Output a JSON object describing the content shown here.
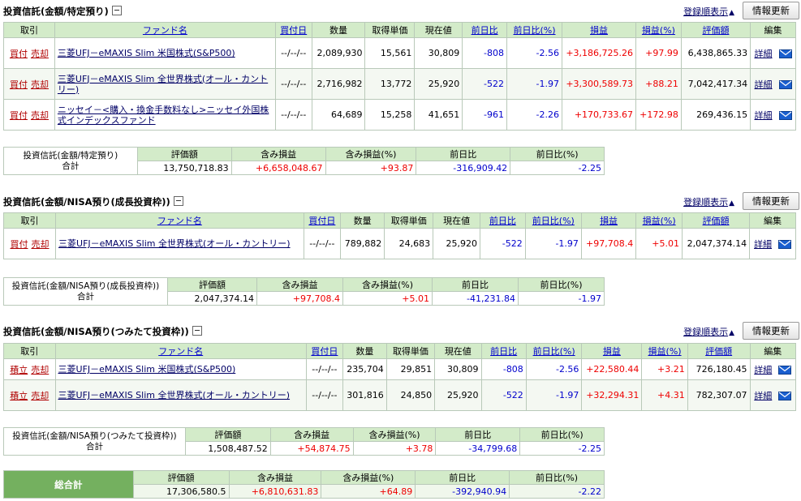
{
  "common": {
    "sort_link": "登録順表示",
    "refresh": "情報更新",
    "edit_detail": "詳細",
    "cols": {
      "trade": "取引",
      "fund": "ファンド名",
      "buy_date": "買付日",
      "qty": "数量",
      "cost": "取得単価",
      "price": "現在値",
      "day_change": "前日比",
      "day_change_pct": "前日比(%)",
      "pl": "損益",
      "pl_pct": "損益(%)",
      "value": "評価額",
      "edit": "編集"
    },
    "sum_cols": {
      "value": "評価額",
      "unrealized": "含み損益",
      "unrealized_pct": "含み損益(%)",
      "day_change": "前日比",
      "day_change_pct": "前日比(%)"
    },
    "total_label": "合計"
  },
  "sections": [
    {
      "title": "投資信託(金額/特定預り)",
      "rows": [
        {
          "act1": "買付",
          "act2": "売却",
          "fund": "三菱UFJ－eMAXIS Slim 米国株式(S&P500)",
          "date": "--/--/--",
          "qty": "2,089,930",
          "cost": "15,561",
          "price": "30,809",
          "chg": "-808",
          "chg_pct": "-2.56",
          "pl": "+3,186,725.26",
          "pl_pct": "+97.99",
          "value": "6,438,865.33"
        },
        {
          "act1": "買付",
          "act2": "売却",
          "fund": "三菱UFJ－eMAXIS Slim 全世界株式(オール・カントリー)",
          "date": "--/--/--",
          "qty": "2,716,982",
          "cost": "13,772",
          "price": "25,920",
          "chg": "-522",
          "chg_pct": "-1.97",
          "pl": "+3,300,589.73",
          "pl_pct": "+88.21",
          "value": "7,042,417.34"
        },
        {
          "act1": "買付",
          "act2": "売却",
          "fund": "ニッセイ－<購入・換金手数料なし>ニッセイ外国株式インデックスファンド",
          "date": "--/--/--",
          "qty": "64,689",
          "cost": "15,258",
          "price": "41,651",
          "chg": "-961",
          "chg_pct": "-2.26",
          "pl": "+170,733.67",
          "pl_pct": "+172.98",
          "value": "269,436.15"
        }
      ],
      "summary": {
        "label": "投資信託(金額/特定預り)",
        "value": "13,750,718.83",
        "unrealized": "+6,658,048.67",
        "unrealized_pct": "+93.87",
        "day_change": "-316,909.42",
        "day_change_pct": "-2.25"
      }
    },
    {
      "title": "投資信託(金額/NISA預り(成長投資枠))",
      "rows": [
        {
          "act1": "買付",
          "act2": "売却",
          "fund": "三菱UFJ－eMAXIS Slim 全世界株式(オール・カントリー)",
          "date": "--/--/--",
          "qty": "789,882",
          "cost": "24,683",
          "price": "25,920",
          "chg": "-522",
          "chg_pct": "-1.97",
          "pl": "+97,708.4",
          "pl_pct": "+5.01",
          "value": "2,047,374.14"
        }
      ],
      "summary": {
        "label": "投資信託(金額/NISA預り(成長投資枠))",
        "value": "2,047,374.14",
        "unrealized": "+97,708.4",
        "unrealized_pct": "+5.01",
        "day_change": "-41,231.84",
        "day_change_pct": "-1.97"
      }
    },
    {
      "title": "投資信託(金額/NISA預り(つみたて投資枠))",
      "rows": [
        {
          "act1": "積立",
          "act2": "売却",
          "fund": "三菱UFJ－eMAXIS Slim 米国株式(S&P500)",
          "date": "--/--/--",
          "qty": "235,704",
          "cost": "29,851",
          "price": "30,809",
          "chg": "-808",
          "chg_pct": "-2.56",
          "pl": "+22,580.44",
          "pl_pct": "+3.21",
          "value": "726,180.45"
        },
        {
          "act1": "積立",
          "act2": "売却",
          "fund": "三菱UFJ－eMAXIS Slim 全世界株式(オール・カントリー)",
          "date": "--/--/--",
          "qty": "301,816",
          "cost": "24,850",
          "price": "25,920",
          "chg": "-522",
          "chg_pct": "-1.97",
          "pl": "+32,294.31",
          "pl_pct": "+4.31",
          "value": "782,307.07"
        }
      ],
      "summary": {
        "label": "投資信託(金額/NISA預り(つみたて投資枠))",
        "value": "1,508,487.52",
        "unrealized": "+54,874.75",
        "unrealized_pct": "+3.78",
        "day_change": "-34,799.68",
        "day_change_pct": "-2.25"
      }
    }
  ],
  "grand_total": {
    "label": "総合計",
    "value": "17,306,580.5",
    "unrealized": "+6,810,631.83",
    "unrealized_pct": "+64.89",
    "day_change": "-392,940.94",
    "day_change_pct": "-2.22"
  },
  "colors": {
    "header_bg": "#d3ebc9",
    "grand_label_bg": "#74b05f",
    "negative": "#0000cc",
    "positive": "#ee0000",
    "fund_link": "#000066",
    "action_link": "#b00000"
  }
}
